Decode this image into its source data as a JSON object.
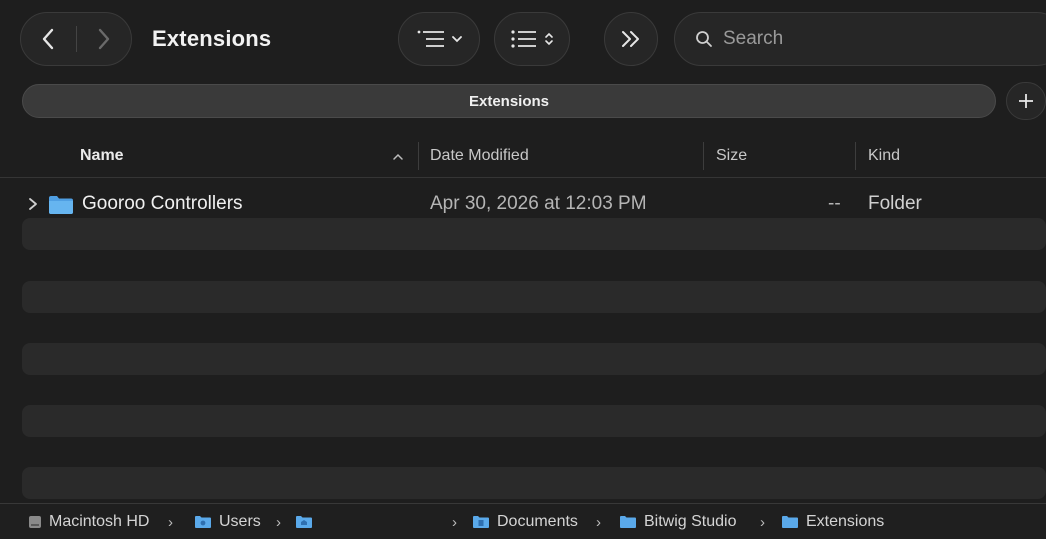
{
  "window": {
    "title": "Extensions"
  },
  "toolbar": {
    "back_icon": "chevron-left",
    "forward_icon": "chevron-right",
    "view_options_icon": "list-view-options",
    "group_icon": "list-group",
    "more_icon": "double-chevron-right"
  },
  "search": {
    "placeholder": "Search",
    "value": ""
  },
  "tabbar": {
    "active_tab": "Extensions",
    "add_tab_icon": "plus"
  },
  "columns": {
    "name": "Name",
    "date_modified": "Date Modified",
    "size": "Size",
    "kind": "Kind",
    "sort_indicator": "^"
  },
  "files": [
    {
      "name": "Gooroo Controllers",
      "date_modified": "Apr 30, 2026 at 12:03 PM",
      "size": "--",
      "kind": "Folder",
      "icon": "folder"
    }
  ],
  "pathbar": {
    "items": [
      {
        "label": "Macintosh HD",
        "icon": "hard-drive"
      },
      {
        "label": "Users",
        "icon": "users-folder"
      },
      {
        "label": "",
        "icon": "home-folder"
      },
      {
        "label": "Documents",
        "icon": "documents-folder"
      },
      {
        "label": "Bitwig Studio",
        "icon": "folder"
      },
      {
        "label": "Extensions",
        "icon": "folder"
      }
    ],
    "separator": "›"
  },
  "colors": {
    "background": "#1e1e1e",
    "folder_blue": "#5aa9ea",
    "stripe": "#2a2a2a"
  }
}
